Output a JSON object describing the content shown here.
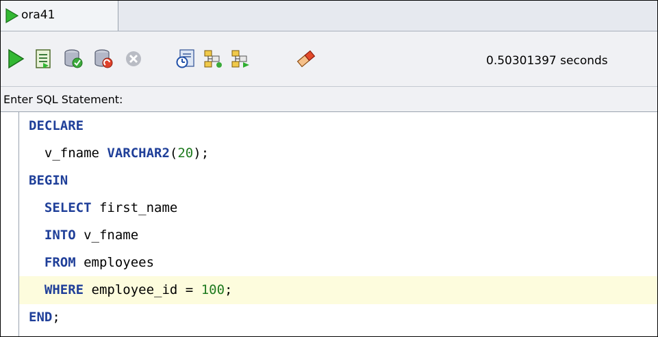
{
  "tab": {
    "label": "ora41"
  },
  "toolbar": {
    "buttons": [
      "run-statement",
      "run-script",
      "commit",
      "rollback",
      "cancel",
      "execution-plan",
      "autotrace",
      "sql-history",
      "clear"
    ],
    "timing": "0.50301397 seconds"
  },
  "editor_label": "Enter SQL Statement:",
  "code": {
    "lines": [
      {
        "tokens": [
          {
            "t": "DECLARE",
            "k": "kw"
          }
        ]
      },
      {
        "tokens": [
          {
            "t": "  v_fname ",
            "k": "plain"
          },
          {
            "t": "VARCHAR2",
            "k": "kw"
          },
          {
            "t": "(",
            "k": "plain"
          },
          {
            "t": "20",
            "k": "num"
          },
          {
            "t": ");",
            "k": "plain"
          }
        ]
      },
      {
        "tokens": [
          {
            "t": "BEGIN",
            "k": "kw"
          }
        ]
      },
      {
        "tokens": [
          {
            "t": "  ",
            "k": "plain"
          },
          {
            "t": "SELECT",
            "k": "kw"
          },
          {
            "t": " first_name",
            "k": "plain"
          }
        ]
      },
      {
        "tokens": [
          {
            "t": "  ",
            "k": "plain"
          },
          {
            "t": "INTO",
            "k": "kw"
          },
          {
            "t": " v_fname",
            "k": "plain"
          }
        ]
      },
      {
        "tokens": [
          {
            "t": "  ",
            "k": "plain"
          },
          {
            "t": "FROM",
            "k": "kw"
          },
          {
            "t": " employees",
            "k": "plain"
          }
        ]
      },
      {
        "tokens": [
          {
            "t": "  ",
            "k": "plain"
          },
          {
            "t": "WHERE",
            "k": "kw"
          },
          {
            "t": " employee_id = ",
            "k": "plain"
          },
          {
            "t": "100",
            "k": "num"
          },
          {
            "t": ";",
            "k": "plain"
          }
        ],
        "highlighted": true
      },
      {
        "tokens": [
          {
            "t": "END",
            "k": "kw"
          },
          {
            "t": ";",
            "k": "plain"
          }
        ]
      }
    ]
  },
  "colors": {
    "keyword": "#1f3f99",
    "number": "#1e7a1e",
    "current_line": "#fdfcdd",
    "run_green": "#2fae2f"
  }
}
